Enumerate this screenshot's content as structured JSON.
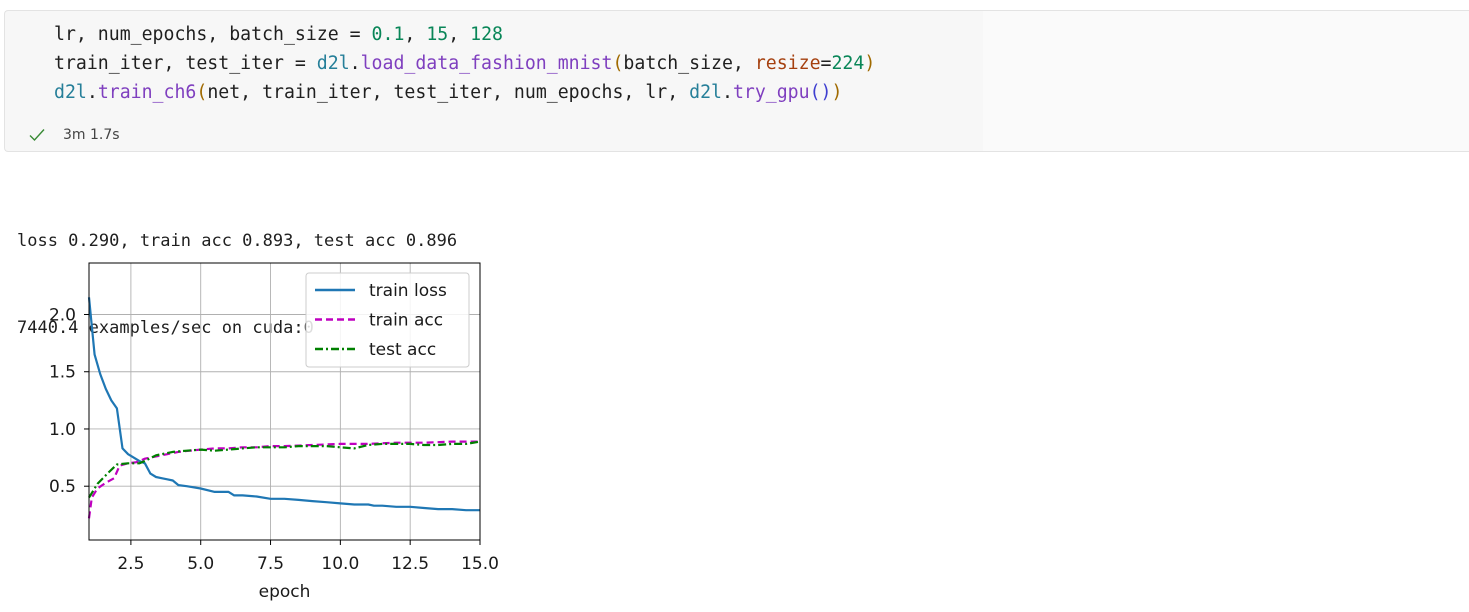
{
  "cell": {
    "code_lines": [
      [
        {
          "t": "lr, num_epochs, batch_size = ",
          "c": ""
        },
        {
          "t": "0.1",
          "c": "tk-num"
        },
        {
          "t": ", ",
          "c": ""
        },
        {
          "t": "15",
          "c": "tk-num"
        },
        {
          "t": ", ",
          "c": ""
        },
        {
          "t": "128",
          "c": "tk-num"
        }
      ],
      [
        {
          "t": "train_iter, test_iter = ",
          "c": ""
        },
        {
          "t": "d2l",
          "c": "tk-mod"
        },
        {
          "t": ".",
          "c": ""
        },
        {
          "t": "load_data_fashion_mnist",
          "c": "tk-fn2"
        },
        {
          "t": "(",
          "c": "tk-p1"
        },
        {
          "t": "batch_size, ",
          "c": ""
        },
        {
          "t": "resize",
          "c": "tk-kw"
        },
        {
          "t": "=",
          "c": ""
        },
        {
          "t": "224",
          "c": "tk-num"
        },
        {
          "t": ")",
          "c": "tk-p1"
        }
      ],
      [
        {
          "t": "d2l",
          "c": "tk-mod"
        },
        {
          "t": ".",
          "c": ""
        },
        {
          "t": "train_ch6",
          "c": "tk-fn2"
        },
        {
          "t": "(",
          "c": "tk-p1"
        },
        {
          "t": "net, train_iter, test_iter, num_epochs, lr, ",
          "c": ""
        },
        {
          "t": "d2l",
          "c": "tk-mod"
        },
        {
          "t": ".",
          "c": ""
        },
        {
          "t": "try_gpu",
          "c": "tk-fn2"
        },
        {
          "t": "(",
          "c": "tk-p2"
        },
        {
          "t": ")",
          "c": "tk-p2"
        },
        {
          "t": ")",
          "c": "tk-p1"
        }
      ]
    ],
    "exec_time": "3m 1.7s",
    "status_icon": "check-icon",
    "status_color": "#388a34"
  },
  "output": {
    "lines": [
      "loss 0.290, train acc 0.893, test acc 0.896",
      "7440.4 examples/sec on cuda:0"
    ]
  },
  "chart_data": {
    "type": "line",
    "xlabel": "epoch",
    "ylabel": "",
    "xlim": [
      1,
      15
    ],
    "ylim": [
      0.03,
      2.45
    ],
    "xticks": [
      "2.5",
      "5.0",
      "7.5",
      "10.0",
      "12.5",
      "15.0"
    ],
    "xtick_values": [
      2.5,
      5.0,
      7.5,
      10.0,
      12.5,
      15.0
    ],
    "yticks": [
      "0.5",
      "1.0",
      "1.5",
      "2.0"
    ],
    "ytick_values": [
      0.5,
      1.0,
      1.5,
      2.0
    ],
    "grid": true,
    "legend_position": "top-right",
    "series": [
      {
        "name": "train loss",
        "color": "#1f77b4",
        "dash": "solid",
        "x": [
          1.0,
          1.2,
          1.4,
          1.6,
          1.8,
          2.0,
          2.2,
          2.4,
          2.6,
          2.8,
          3.0,
          3.2,
          3.4,
          3.6,
          3.8,
          4.0,
          4.2,
          4.5,
          5.0,
          5.5,
          6.0,
          6.2,
          6.5,
          7.0,
          7.5,
          8.0,
          8.5,
          9.0,
          9.5,
          10.0,
          10.5,
          11.0,
          11.2,
          11.5,
          12.0,
          12.5,
          13.0,
          13.5,
          14.0,
          14.5,
          15.0
        ],
        "y": [
          2.15,
          1.65,
          1.48,
          1.35,
          1.25,
          1.18,
          0.83,
          0.78,
          0.75,
          0.72,
          0.7,
          0.61,
          0.58,
          0.57,
          0.56,
          0.55,
          0.51,
          0.5,
          0.48,
          0.45,
          0.45,
          0.42,
          0.42,
          0.41,
          0.39,
          0.39,
          0.38,
          0.37,
          0.36,
          0.35,
          0.34,
          0.34,
          0.33,
          0.33,
          0.32,
          0.32,
          0.31,
          0.3,
          0.3,
          0.29,
          0.29
        ]
      },
      {
        "name": "train acc",
        "color": "#bf00bf",
        "dash": "dashed",
        "x": [
          1.0,
          1.1,
          1.3,
          1.6,
          1.9,
          2.1,
          2.4,
          2.7,
          3.0,
          3.4,
          3.8,
          4.2,
          4.6,
          5.0,
          5.5,
          6.0,
          6.5,
          7.0,
          7.5,
          8.0,
          9.0,
          10.0,
          11.0,
          12.0,
          13.0,
          14.0,
          15.0
        ],
        "y": [
          0.22,
          0.4,
          0.48,
          0.53,
          0.57,
          0.68,
          0.7,
          0.71,
          0.74,
          0.76,
          0.78,
          0.8,
          0.81,
          0.82,
          0.83,
          0.83,
          0.84,
          0.84,
          0.85,
          0.85,
          0.86,
          0.87,
          0.87,
          0.88,
          0.88,
          0.89,
          0.89
        ]
      },
      {
        "name": "test acc",
        "color": "#008000",
        "dash": "dashdot",
        "x": [
          1.0,
          1.3,
          1.7,
          2.0,
          2.4,
          2.8,
          3.0,
          3.4,
          4.0,
          4.5,
          5.0,
          5.5,
          6.0,
          6.5,
          7.0,
          7.5,
          8.0,
          8.5,
          9.0,
          9.5,
          10.0,
          10.5,
          11.0,
          11.5,
          12.0,
          12.5,
          13.0,
          13.5,
          14.0,
          14.5,
          15.0
        ],
        "y": [
          0.4,
          0.52,
          0.62,
          0.69,
          0.7,
          0.7,
          0.72,
          0.77,
          0.8,
          0.81,
          0.82,
          0.81,
          0.82,
          0.83,
          0.84,
          0.84,
          0.84,
          0.85,
          0.85,
          0.85,
          0.84,
          0.83,
          0.86,
          0.87,
          0.87,
          0.87,
          0.86,
          0.86,
          0.87,
          0.87,
          0.89
        ]
      }
    ]
  }
}
